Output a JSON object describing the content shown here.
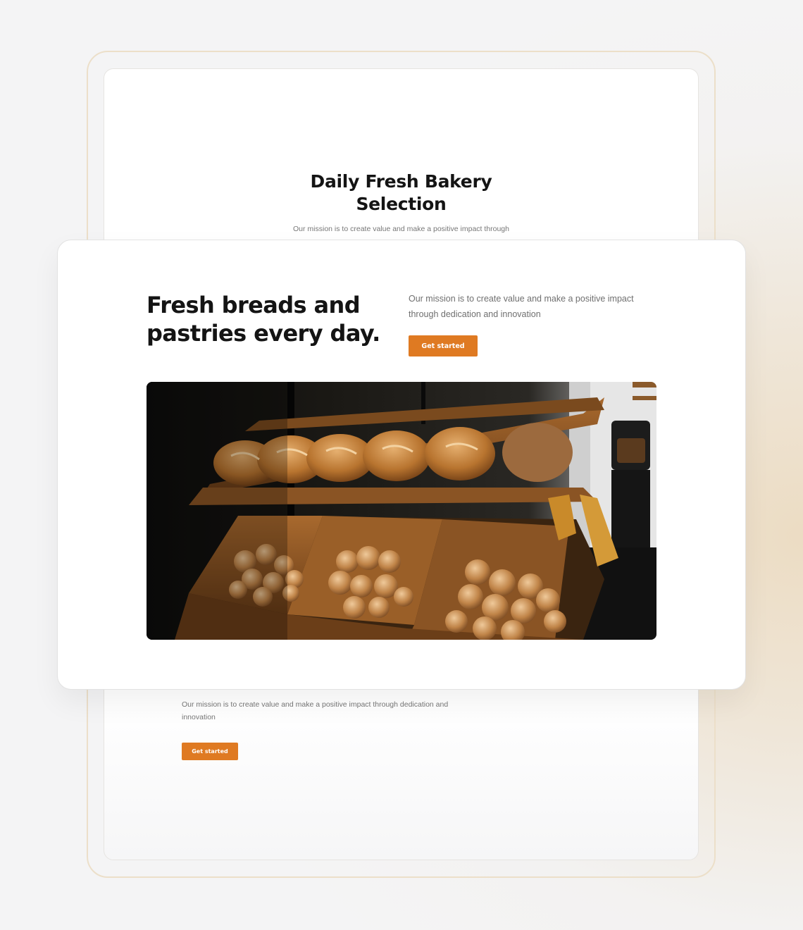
{
  "back_page": {
    "title_line1": "Daily Fresh Bakery",
    "title_line2": "Selection",
    "subtitle": "Our mission is to create value and make a positive impact through",
    "lower_text": "Our mission is to create value and make a positive impact through dedication and innovation",
    "cta_label": "Get started"
  },
  "hero": {
    "heading_line1": "Fresh breads and",
    "heading_line2": "pastries every day.",
    "description": "Our mission is to create value and make a positive impact through dedication and innovation",
    "cta_label": "Get started",
    "image_subject": "bread-display-photo"
  },
  "colors": {
    "accent": "#df7a22",
    "heading": "#141414",
    "body_text": "#6f6f6f",
    "frame": "#ecdfc9"
  }
}
